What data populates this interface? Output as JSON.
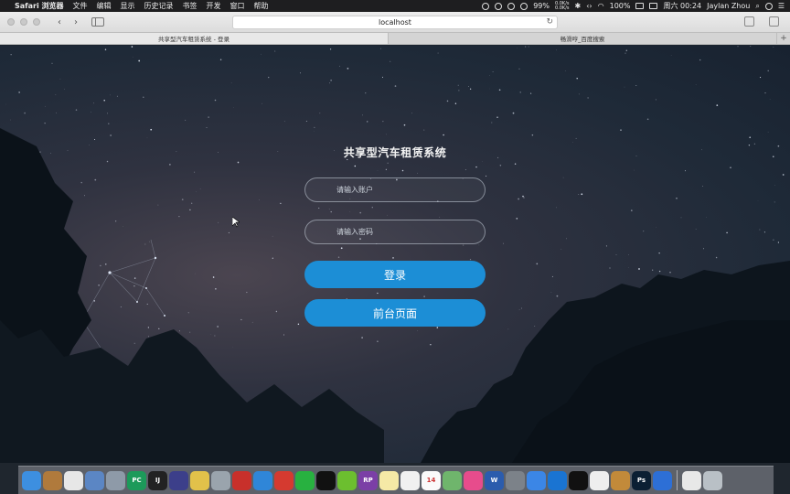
{
  "menubar": {
    "app_name": "Safari 浏览器",
    "menus": [
      "文件",
      "编辑",
      "显示",
      "历史记录",
      "书签",
      "开发",
      "窗口",
      "帮助"
    ],
    "net_up": "0.0K/s",
    "net_down": "0.0K/s",
    "battery": "99%",
    "battery2": "100%",
    "clock": "周六 00:24",
    "user": "Jaylan Zhou"
  },
  "browser": {
    "url": "localhost",
    "tabs": [
      {
        "label": "共享型汽车租赁系统 - 登录",
        "active": true
      },
      {
        "label": "畅滑哼_百度搜索",
        "active": false
      }
    ],
    "new_tab_symbol": "+"
  },
  "login": {
    "title": "共享型汽车租赁系统",
    "account_placeholder": "请输入账户",
    "password_placeholder": "请输入密码",
    "login_button": "登录",
    "front_button": "前台页面"
  },
  "dock": {
    "apps": [
      {
        "name": "finder-icon",
        "color": "#3d8fe0"
      },
      {
        "name": "notes-book-icon",
        "color": "#b07a3c"
      },
      {
        "name": "photos-icon",
        "color": "#e7e7e7"
      },
      {
        "name": "preview-icon",
        "color": "#5b86c4"
      },
      {
        "name": "launchpad-icon",
        "color": "#8e9aa8"
      },
      {
        "name": "pycharm-icon",
        "color": "#1c9a5a",
        "text": "PC"
      },
      {
        "name": "intellij-icon",
        "color": "#222",
        "text": "IJ"
      },
      {
        "name": "eclipse-icon",
        "color": "#3c3f8a"
      },
      {
        "name": "sequel-icon",
        "color": "#e2c14a"
      },
      {
        "name": "disk-utility-icon",
        "color": "#9aa4ad"
      },
      {
        "name": "redis-icon",
        "color": "#c8302b"
      },
      {
        "name": "safari-icon",
        "color": "#2f86d8"
      },
      {
        "name": "mail-icon",
        "color": "#d53a30"
      },
      {
        "name": "wechat-icon",
        "color": "#28b140"
      },
      {
        "name": "qq-icon",
        "color": "#111"
      },
      {
        "name": "green-app-icon",
        "color": "#6cbf2f"
      },
      {
        "name": "axure-icon",
        "color": "#7b3fa6",
        "text": "RP"
      },
      {
        "name": "notes-icon",
        "color": "#f5e9a6"
      },
      {
        "name": "list-icon",
        "color": "#f0f0f0"
      },
      {
        "name": "calendar-icon",
        "color": "#fafafa",
        "text": "14"
      },
      {
        "name": "maps-icon",
        "color": "#6fb56c"
      },
      {
        "name": "itunes-icon",
        "color": "#e74c8c"
      },
      {
        "name": "word-icon",
        "color": "#2b5cad",
        "text": "W"
      },
      {
        "name": "system-prefs-icon",
        "color": "#7c8289"
      },
      {
        "name": "baidu-cloud-icon",
        "color": "#3b86e6"
      },
      {
        "name": "teamviewer-icon",
        "color": "#1a74d2"
      },
      {
        "name": "qq-icon-2",
        "color": "#111"
      },
      {
        "name": "textedit-icon",
        "color": "#eeeeee"
      },
      {
        "name": "keynote-icon",
        "color": "#c28a3a"
      },
      {
        "name": "photoshop-icon",
        "color": "#0b1f33",
        "text": "Ps"
      },
      {
        "name": "chrome-canary-icon",
        "color": "#2d6fd6"
      }
    ],
    "trailing": [
      {
        "name": "document-icon",
        "color": "#e8e8e8"
      },
      {
        "name": "trash-icon",
        "color": "#b9c0c6"
      }
    ]
  }
}
